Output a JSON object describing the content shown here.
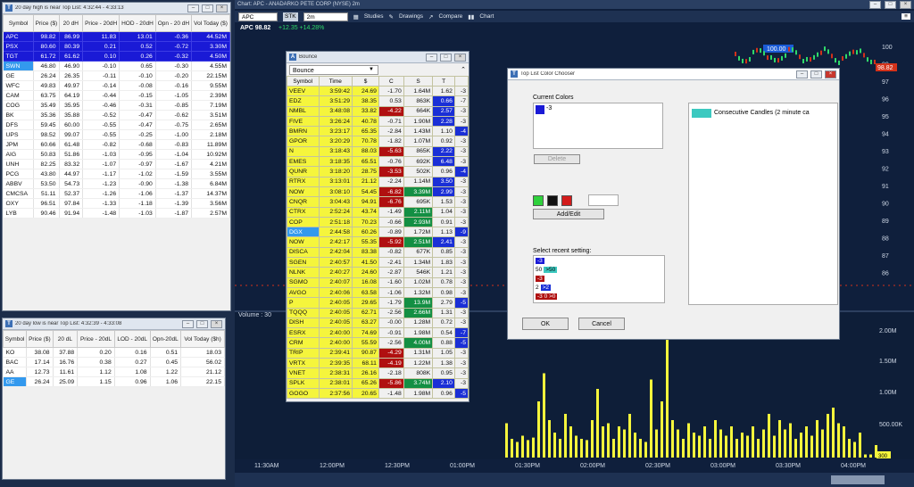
{
  "high_list": {
    "title": "20 day high is near Top List: 4:32:44 - 4:33:13",
    "columns": [
      "Symbol",
      "Price ($)",
      "20 dH",
      "Price - 20dH",
      "HOD - 20dH",
      "Opn - 20 dH",
      "Vol Today ($)"
    ],
    "rows": [
      [
        "APC",
        "98.82",
        "86.99",
        "11.83",
        "13.01",
        "-0.36",
        "44.52M"
      ],
      [
        "PSX",
        "80.60",
        "80.39",
        "0.21",
        "0.52",
        "-0.72",
        "3.30M"
      ],
      [
        "TGT",
        "61.72",
        "61.62",
        "0.10",
        "0.26",
        "-0.32",
        "4.50M"
      ],
      [
        "SWN",
        "46.80",
        "46.90",
        "-0.10",
        "0.65",
        "-0.30",
        "4.55M"
      ],
      [
        "GE",
        "26.24",
        "26.35",
        "-0.11",
        "-0.10",
        "-0.20",
        "22.15M"
      ],
      [
        "WFC",
        "49.83",
        "49.97",
        "-0.14",
        "-0.08",
        "-0.16",
        "9.55M"
      ],
      [
        "CAM",
        "63.75",
        "64.19",
        "-0.44",
        "-0.15",
        "-1.05",
        "2.39M"
      ],
      [
        "COG",
        "35.49",
        "35.95",
        "-0.46",
        "-0.31",
        "-0.85",
        "7.19M"
      ],
      [
        "BK",
        "35.36",
        "35.88",
        "-0.52",
        "-0.47",
        "-0.62",
        "3.51M"
      ],
      [
        "DFS",
        "59.45",
        "60.00",
        "-0.55",
        "-0.47",
        "-0.75",
        "2.65M"
      ],
      [
        "UPS",
        "98.52",
        "99.07",
        "-0.55",
        "-0.25",
        "-1.00",
        "2.18M"
      ],
      [
        "JPM",
        "60.66",
        "61.48",
        "-0.82",
        "-0.68",
        "-0.83",
        "11.89M"
      ],
      [
        "AIG",
        "50.83",
        "51.86",
        "-1.03",
        "-0.95",
        "-1.04",
        "10.92M"
      ],
      [
        "UNH",
        "82.25",
        "83.32",
        "-1.07",
        "-0.97",
        "-1.67",
        "4.21M"
      ],
      [
        "PCG",
        "43.80",
        "44.97",
        "-1.17",
        "-1.02",
        "-1.59",
        "3.55M"
      ],
      [
        "ABBV",
        "53.50",
        "54.73",
        "-1.23",
        "-0.90",
        "-1.38",
        "6.84M"
      ],
      [
        "CMCSA",
        "51.11",
        "52.37",
        "-1.26",
        "-1.06",
        "-1.37",
        "14.37M"
      ],
      [
        "OXY",
        "96.51",
        "97.84",
        "-1.33",
        "-1.18",
        "-1.39",
        "3.56M"
      ],
      [
        "LYB",
        "90.46",
        "91.94",
        "-1.48",
        "-1.03",
        "-1.87",
        "2.57M"
      ]
    ]
  },
  "low_list": {
    "title": "20 day low is near Top List: 4:32:39 - 4:33:08",
    "columns": [
      "Symbol",
      "Price ($)",
      "20 dL",
      "Price - 20dL",
      "LOD - 20dL",
      "Opn-20dL",
      "Vol Today ($h)"
    ],
    "rows": [
      [
        "KO",
        "38.08",
        "37.88",
        "0.20",
        "0.16",
        "0.51",
        "18.03"
      ],
      [
        "BAC",
        "17.14",
        "16.76",
        "0.38",
        "0.27",
        "0.45",
        "56.02"
      ],
      [
        "AA",
        "12.73",
        "11.61",
        "1.12",
        "1.08",
        "1.22",
        "21.12"
      ],
      [
        "GE",
        "26.24",
        "25.09",
        "1.15",
        "0.96",
        "1.06",
        "22.15"
      ]
    ]
  },
  "chart": {
    "title": "Chart: APC - ANADARKO PETE CORP (NYSE) 2m",
    "symbol_input": "APC",
    "period": "2m",
    "studies": "Studies",
    "drawings": "Drawings",
    "compare": "Compare",
    "chart_btn": "Chart",
    "price": "APC 98.82",
    "change": "+12.35 +14.28%",
    "axis_prices": [
      "100",
      "99",
      "97",
      "96",
      "95",
      "94",
      "93",
      "92",
      "91",
      "90",
      "89",
      "88",
      "87",
      "86"
    ],
    "last_price_tag": "98.82",
    "price_marker": "100.00",
    "volume_label": "Volume : 30",
    "volume_axis": [
      "2.00M",
      "1.50M",
      "1.00M",
      "500.00K"
    ],
    "volume_tag": "300",
    "time_ticks": [
      "11:30AM",
      "12:00PM",
      "12:30PM",
      "01:00PM",
      "01:30PM",
      "02:00PM",
      "02:30PM",
      "03:00PM",
      "03:30PM",
      "04:00PM"
    ]
  },
  "bounce": {
    "title": "Bounce",
    "dropdown": "Bounce",
    "columns": [
      "Symbol",
      "Time",
      "$",
      "C",
      "S",
      "T",
      "",
      ""
    ],
    "rows": [
      [
        "VEEV",
        "3:59:42",
        "24.69",
        "-1.70",
        "1.64M",
        "1.62",
        "-3",
        ""
      ],
      [
        "EDZ",
        "3:51:29",
        "38.35",
        "0.53",
        "863K",
        "0.66",
        "-7",
        "b"
      ],
      [
        "NMBL",
        "3:48:08",
        "33.82",
        "-4.22",
        "664K",
        "2.57",
        "-3",
        "rb"
      ],
      [
        "FIVE",
        "3:26:24",
        "40.78",
        "-0.71",
        "1.90M",
        "2.28",
        "-3",
        "b"
      ],
      [
        "BMRN",
        "3:23:17",
        "65.35",
        "-2.84",
        "1.43M",
        "1.10",
        "-4",
        "x"
      ],
      [
        "GPOR",
        "3:20:29",
        "70.78",
        "-1.82",
        "1.07M",
        "0.92",
        "-3",
        ""
      ],
      [
        "N",
        "3:18:43",
        "88.03",
        "-5.63",
        "865K",
        "2.22",
        "-3",
        "rb"
      ],
      [
        "EMES",
        "3:18:35",
        "65.51",
        "-0.76",
        "692K",
        "6.48",
        "-3",
        "b"
      ],
      [
        "QUNR",
        "3:18:20",
        "28.75",
        "-3.53",
        "502K",
        "0.96",
        "-4",
        "rx"
      ],
      [
        "RTRX",
        "3:13:01",
        "21.12",
        "-2.24",
        "1.14M",
        "3.50",
        "-3",
        "b"
      ],
      [
        "NOW",
        "3:08:10",
        "54.45",
        "-6.82",
        "3.39M",
        "2.99",
        "-3",
        "rgb"
      ],
      [
        "CNQR",
        "3:04:43",
        "94.91",
        "-6.76",
        "695K",
        "1.53",
        "-3",
        "r"
      ],
      [
        "CTRX",
        "2:52:24",
        "43.74",
        "-1.49",
        "2.11M",
        "1.04",
        "-3",
        "g"
      ],
      [
        "COP",
        "2:51:18",
        "70.23",
        "-0.66",
        "2.93M",
        "0.91",
        "-3",
        "g"
      ],
      [
        "DGX",
        "2:44:58",
        "60.26",
        "-0.89",
        "1.72M",
        "1.13",
        "-9",
        "sx"
      ],
      [
        "NOW",
        "2:42:17",
        "55.35",
        "-5.92",
        "2.51M",
        "2.41",
        "-3",
        "rgb"
      ],
      [
        "DISCA",
        "2:42:04",
        "83.38",
        "-0.82",
        "677K",
        "0.85",
        "-3",
        ""
      ],
      [
        "SGEN",
        "2:40:57",
        "41.50",
        "-2.41",
        "1.34M",
        "1.83",
        "-3",
        ""
      ],
      [
        "NLNK",
        "2:40:27",
        "24.60",
        "-2.87",
        "546K",
        "1.21",
        "-3",
        ""
      ],
      [
        "SGMO",
        "2:40:07",
        "16.08",
        "-1.60",
        "1.02M",
        "0.78",
        "-3",
        ""
      ],
      [
        "AVGO",
        "2:40:06",
        "63.58",
        "-1.06",
        "1.32M",
        "0.98",
        "-3",
        ""
      ],
      [
        "P",
        "2:40:05",
        "29.65",
        "-1.79",
        "13.9M",
        "2.79",
        "-5",
        "gx"
      ],
      [
        "TQQQ",
        "2:40:05",
        "62.71",
        "-2.56",
        "2.66M",
        "1.31",
        "-3",
        "g"
      ],
      [
        "DISH",
        "2:40:05",
        "63.27",
        "-0.00",
        "1.28M",
        "0.72",
        "-3",
        ""
      ],
      [
        "ESRX",
        "2:40:00",
        "74.69",
        "-0.91",
        "1.98M",
        "0.54",
        "-7",
        "x"
      ],
      [
        "CRM",
        "2:40:00",
        "55.59",
        "-2.56",
        "4.00M",
        "0.88",
        "-5",
        "gx"
      ],
      [
        "TRIP",
        "2:39:41",
        "90.87",
        "-4.29",
        "1.31M",
        "1.05",
        "-3",
        "r"
      ],
      [
        "VRTX",
        "2:39:35",
        "68.11",
        "-4.19",
        "1.22M",
        "1.38",
        "-3",
        "r"
      ],
      [
        "VNET",
        "2:38:31",
        "26.16",
        "-2.18",
        "808K",
        "0.95",
        "-3",
        ""
      ],
      [
        "SPLK",
        "2:38:01",
        "65.26",
        "-5.86",
        "3.74M",
        "2.10",
        "-3",
        "rgb"
      ],
      [
        "GOGO",
        "2:37:56",
        "20.65",
        "-1.48",
        "1.98M",
        "0.96",
        "-5",
        "x"
      ]
    ]
  },
  "dialog": {
    "title": "Top List Color Chooser",
    "current_colors_label": "Current Colors",
    "current_value": "-3",
    "delete_label": "Delete",
    "add_edit_label": "Add/Edit",
    "select_recent_label": "Select recent setting:",
    "recent": [
      "-3",
      ">50",
      "-3",
      ">2",
      "-3  0  >0"
    ],
    "recent_prefix": [
      "",
      "50",
      "",
      "2",
      ""
    ],
    "preview_text": "Consecutive Candles (2 minute ca",
    "ok_label": "OK",
    "cancel_label": "Cancel"
  },
  "chart_data": {
    "type": "bar",
    "title": "",
    "ylabel": "",
    "xlabel": "",
    "volumes": [
      0.55,
      0.3,
      0.25,
      0.35,
      0.28,
      0.32,
      0.9,
      1.35,
      0.6,
      0.4,
      0.3,
      0.7,
      0.5,
      0.35,
      0.3,
      0.28,
      0.6,
      1.1,
      0.5,
      0.55,
      0.3,
      0.5,
      0.45,
      0.7,
      0.4,
      0.3,
      0.25,
      1.25,
      0.45,
      0.9,
      1.9,
      0.6,
      0.45,
      0.3,
      0.55,
      0.4,
      0.35,
      0.5,
      0.3,
      0.6,
      0.45,
      0.35,
      0.5,
      0.3,
      0.4,
      0.35,
      0.5,
      0.3,
      0.45,
      0.7,
      0.35,
      0.6,
      0.45,
      0.55,
      0.3,
      0.4,
      0.5,
      0.35,
      0.6,
      0.45,
      0.7,
      0.8,
      0.55,
      0.5,
      0.3,
      0.25,
      0.4,
      0.05,
      0.05,
      0.2
    ],
    "ylim": [
      0,
      2.0
    ]
  }
}
